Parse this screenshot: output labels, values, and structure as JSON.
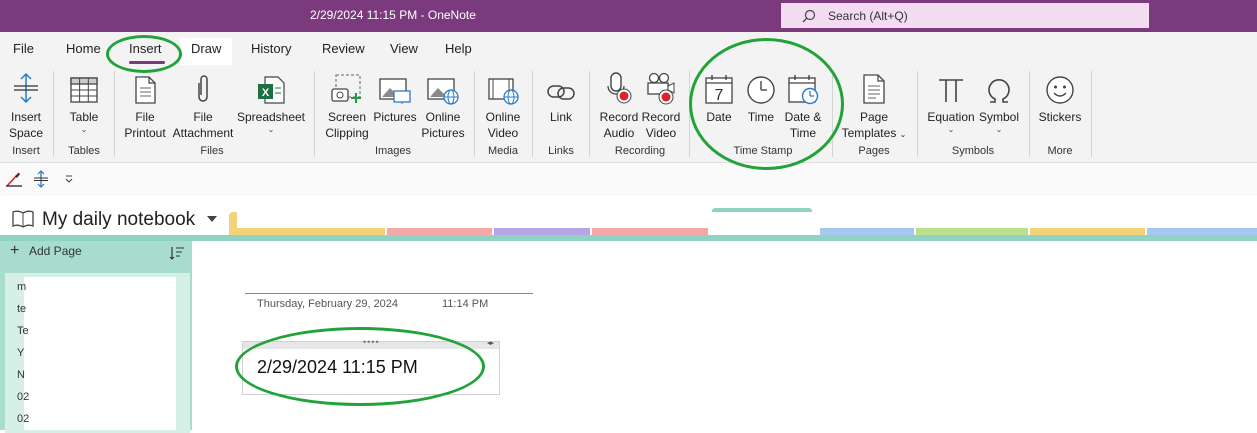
{
  "app": {
    "title": "2/29/2024 11:15 PM  -  OneNote",
    "search_placeholder": "Search (Alt+Q)"
  },
  "tabs": [
    "File",
    "Home",
    "Insert",
    "Draw",
    "History",
    "Review",
    "View",
    "Help"
  ],
  "active_tab": "Insert",
  "ribbon": {
    "items": {
      "insert_space": "Insert\nSpace",
      "table": "Table",
      "file_printout": "File\nPrintout",
      "file_attachment": "File\nAttachment",
      "spreadsheet": "Spreadsheet",
      "screen_clipping": "Screen\nClipping",
      "pictures": "Pictures",
      "online_pictures": "Online\nPictures",
      "online_video": "Online\nVideo",
      "link": "Link",
      "record_audio": "Record\nAudio",
      "record_video": "Record\nVideo",
      "date": "Date",
      "time": "Time",
      "date_time": "Date &\nTime",
      "page_templates": "Page\nTemplates",
      "equation": "Equation",
      "symbol": "Symbol",
      "stickers": "Stickers"
    },
    "groups": {
      "insert": "Insert",
      "tables": "Tables",
      "files": "Files",
      "images": "Images",
      "media": "Media",
      "links": "Links",
      "recording": "Recording",
      "time_stamp": "Time Stamp",
      "pages": "Pages",
      "symbols": "Symbols",
      "more": "More"
    },
    "date_icon_number": "7"
  },
  "notebook": {
    "name": "My daily notebook"
  },
  "page_pane": {
    "add_page": "Add Page",
    "pages": [
      "m",
      "te",
      "Te",
      "Y",
      "N",
      "02",
      "02"
    ]
  },
  "page": {
    "date": "Thursday, February 29, 2024",
    "time": "11:14 PM",
    "note_text": "2/29/2024 11:15 PM"
  },
  "colors": {
    "titlebar": "#7b3a7e",
    "search_bg": "#f3dcf2",
    "annotation": "#21a339",
    "pane_teal": "#a8dccd"
  }
}
